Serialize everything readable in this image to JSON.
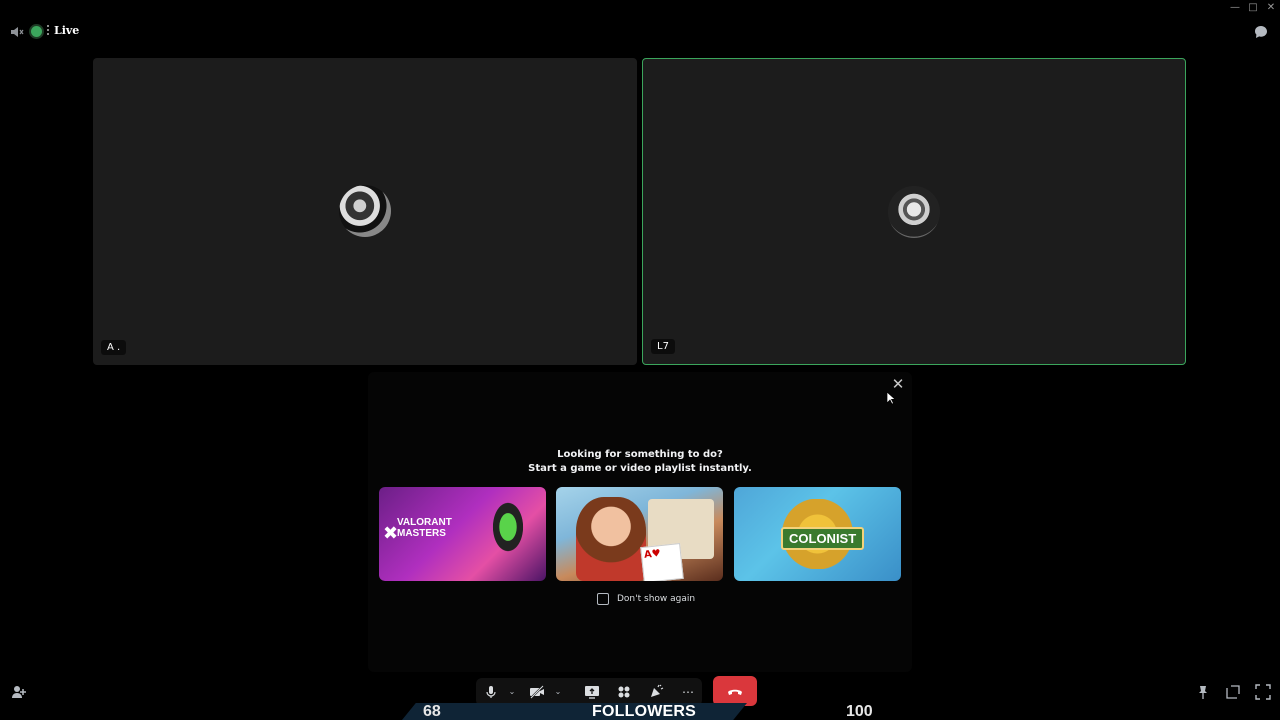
{
  "topbar": {
    "status_label": "Live",
    "status_color": "#3ba55c",
    "icons": [
      "speaker-muted-icon",
      "chat-bubble-icon"
    ],
    "window_controls": [
      "minimize",
      "maximize",
      "close"
    ]
  },
  "tiles": [
    {
      "name": "A .",
      "avatar": "user-avatar",
      "speaking": false
    },
    {
      "name": "L7",
      "avatar": "user-avatar",
      "speaking": true,
      "speaking_color": "#3ba55c"
    }
  ],
  "activity_popup": {
    "title": "Looking for something to do?",
    "subtitle": "Start a game or video playlist instantly.",
    "cards": [
      {
        "name": "valorant-masters-card",
        "text": "VALORANT MASTERS"
      },
      {
        "name": "solitaire-card",
        "text": ""
      },
      {
        "name": "colonist-card",
        "text": "COLONIST"
      }
    ],
    "checkbox_label": "Don't show again",
    "checked": false
  },
  "controls": {
    "buttons": [
      "microphone-icon",
      "camera-off-icon",
      "screen-share-icon",
      "activities-icon",
      "soundboard-icon",
      "more-icon",
      "hang-up-icon"
    ],
    "hangup_color": "#da373c",
    "side_left": "invite-icon",
    "side_right": [
      "pin-icon",
      "popout-icon",
      "fullscreen-icon"
    ]
  },
  "stream_overlay": {
    "left_number": "68",
    "label": "FOLLOWERS",
    "right_number": "100"
  }
}
